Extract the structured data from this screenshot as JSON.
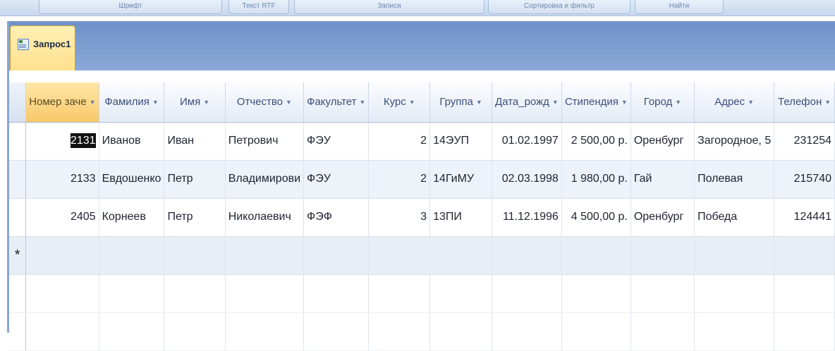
{
  "ribbon": {
    "groups": [
      {
        "label": "Шрифт"
      },
      {
        "label": "Текст RTF"
      },
      {
        "label": "Записи"
      },
      {
        "label": "Сортировка и фильтр"
      },
      {
        "label": "Найти"
      }
    ]
  },
  "document": {
    "tab_label": "Запрос1"
  },
  "grid": {
    "columns": [
      {
        "label": "Номер заче"
      },
      {
        "label": "Фамилия"
      },
      {
        "label": "Имя"
      },
      {
        "label": "Отчество"
      },
      {
        "label": "Факультет"
      },
      {
        "label": "Курс"
      },
      {
        "label": "Группа"
      },
      {
        "label": "Дата_рожд"
      },
      {
        "label": "Стипендия"
      },
      {
        "label": "Город"
      },
      {
        "label": "Адрес"
      },
      {
        "label": "Телефон"
      }
    ],
    "rows": [
      {
        "cells": [
          "2131",
          "Иванов",
          "Иван",
          "Петрович",
          "ФЭУ",
          "2",
          "14ЭУП",
          "01.02.1997",
          "2 500,00 р.",
          "Оренбург",
          "Загородное, 5",
          "231254"
        ]
      },
      {
        "cells": [
          "2133",
          "Евдошенко",
          "Петр",
          "Владимирови",
          "ФЭУ",
          "2",
          "14ГиМУ",
          "02.03.1998",
          "1 980,00 р.",
          "Гай",
          "Полевая",
          "215740"
        ]
      },
      {
        "cells": [
          "2405",
          "Корнеев",
          "Петр",
          "Николаевич",
          "ФЭФ",
          "3",
          "13ПИ",
          "11.12.1996",
          "4 500,00 р.",
          "Оренбург",
          "Победа",
          "124441"
        ]
      }
    ],
    "new_row_marker": "*"
  }
}
